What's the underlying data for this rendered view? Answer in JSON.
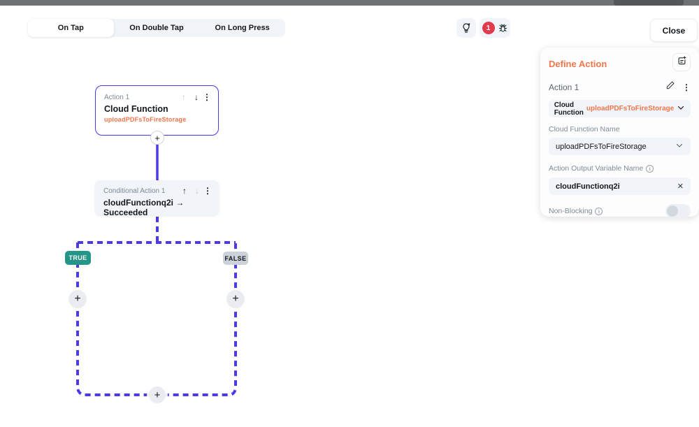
{
  "toolbar": {
    "tabs": [
      {
        "label": "On Tap",
        "active": true
      },
      {
        "label": "On Double Tap",
        "active": false
      },
      {
        "label": "On Long Press",
        "active": false
      }
    ],
    "error_badge_count": "1",
    "close_label": "Close"
  },
  "canvas": {
    "action_card": {
      "label": "Action 1",
      "title": "Cloud Function",
      "subtitle": "uploadPDFsToFireStorage",
      "up_arrow": "↑",
      "down_arrow": "↓",
      "kebab": "⋮"
    },
    "conditional_card": {
      "label": "Conditional Action 1",
      "title": "cloudFunctionq2i → Succeeded",
      "up_arrow": "↑",
      "down_arrow": "↓",
      "kebab": "⋮"
    },
    "true_label": "TRUE",
    "false_label": "FALSE",
    "plus_label": "+"
  },
  "panel": {
    "title": "Define Action",
    "section_label": "Action 1",
    "kebab": "⋮",
    "action_type_prefix": "Cloud Function",
    "action_type_value": "uploadPDFsToFireStorage",
    "function_name_label": "Cloud Function Name",
    "function_name_value": "uploadPDFsToFireStorage",
    "output_var_label": "Action Output Variable Name",
    "output_var_value": "cloudFunctionq2i",
    "clear_x": "✕",
    "info_i": "i",
    "non_blocking_label": "Non-Blocking"
  },
  "colors": {
    "accent_purple": "#4b39ef",
    "accent_orange": "#f2764a",
    "true_green": "#249689",
    "false_gray": "#ccd2d9",
    "error_red": "#e03a4c",
    "field_gray": "#f1f4f8",
    "text_dark": "#14181b",
    "text_gray": "#7d8a96"
  }
}
